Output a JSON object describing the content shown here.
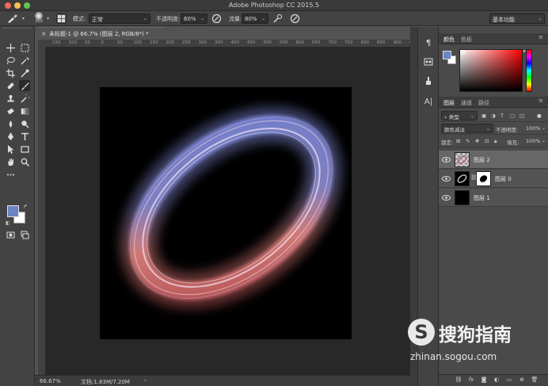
{
  "window": {
    "title": "Adobe Photoshop CC 2015.5"
  },
  "options_bar": {
    "brush_size": "300",
    "mode_label": "模式:",
    "mode_value": "正常",
    "opacity_label": "不透明度:",
    "opacity_value": "60%",
    "flow_label": "流量:",
    "flow_value": "80%",
    "workspace": "基本功能"
  },
  "document": {
    "tab_title": "未标题-1 @ 66.7% (图层 2, RGB/8*) *",
    "ruler_ticks": [
      "150",
      "100",
      "50",
      "0",
      "50",
      "100",
      "150",
      "200",
      "250",
      "300",
      "350",
      "400",
      "450",
      "500",
      "550",
      "600",
      "650",
      "700",
      "750",
      "800",
      "850",
      "900",
      "950"
    ],
    "zoom": "66.67%",
    "doc_size": "文档:1.83M/7.20M"
  },
  "tools": {
    "foreground_color": "#6b84c6",
    "background_color": "#ffffff"
  },
  "panels": {
    "color_tabs": [
      "颜色",
      "色板"
    ],
    "layers_tabs": [
      "图层",
      "通道",
      "路径"
    ],
    "filter_kind": "类型",
    "blend_mode": "颜色减淡",
    "opacity_label": "不透明度:",
    "opacity_value": "100%",
    "lock_label": "锁定:",
    "fill_label": "填充:",
    "fill_value": "100%",
    "layers": [
      {
        "name": "图层 2",
        "selected": true
      },
      {
        "name": "图层 0",
        "selected": false
      },
      {
        "name": "图层 1",
        "selected": false
      }
    ]
  },
  "watermark": {
    "logo_letter": "S",
    "brand": "搜狗指南",
    "url": "zhinan.sogou.com"
  }
}
